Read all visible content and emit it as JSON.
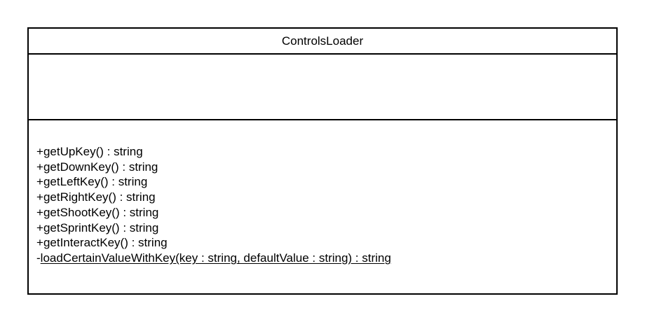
{
  "uml_class": {
    "name": "ControlsLoader",
    "attributes": [],
    "operations": [
      {
        "visibility": "+",
        "signature": "getUpKey() : string",
        "static": false
      },
      {
        "visibility": "+",
        "signature": "getDownKey() : string",
        "static": false
      },
      {
        "visibility": "+",
        "signature": "getLeftKey() : string",
        "static": false
      },
      {
        "visibility": "+",
        "signature": "getRightKey() : string",
        "static": false
      },
      {
        "visibility": "+",
        "signature": "getShootKey() : string",
        "static": false
      },
      {
        "visibility": "+",
        "signature": "getSprintKey() : string",
        "static": false
      },
      {
        "visibility": "+",
        "signature": "getInteractKey() : string",
        "static": false
      },
      {
        "visibility": "-",
        "signature": "loadCertainValueWithKey(key : string, defaultValue : string) : string",
        "static": true
      }
    ]
  }
}
